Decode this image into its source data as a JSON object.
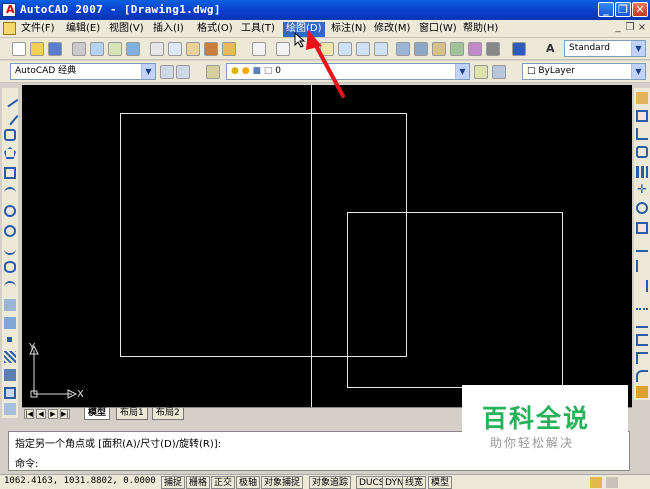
{
  "window": {
    "title": "AutoCAD 2007 - [Drawing1.dwg]",
    "minimize_glyph": "_",
    "restore_glyph": "❐",
    "close_glyph": "✕"
  },
  "menu": {
    "items": [
      "文件(F)",
      "编辑(E)",
      "视图(V)",
      "插入(I)",
      "格式(O)",
      "工具(T)",
      "绘图(D)",
      "标注(N)",
      "修改(M)",
      "窗口(W)",
      "帮助(H)"
    ],
    "highlighted": "绘图(D)",
    "mdi_minimize": "_",
    "mdi_restore": "❐",
    "mdi_close": "×"
  },
  "toolbar": {
    "text_style_value": "Standard",
    "workspace_value": "AutoCAD 经典",
    "layer_value": "0",
    "color_value": "ByLayer"
  },
  "tabs": [
    "模型",
    "布局1",
    "布局2"
  ],
  "active_tab": "模型",
  "ucs": {
    "y_label": "Y",
    "x_label": "X"
  },
  "command": {
    "line1": "指定另一个角点或 [面积(A)/尺寸(D)/旋转(R)]:",
    "line2": "命令:"
  },
  "status": {
    "coordinates": "1062.4163, 1031.8802, 0.0000",
    "toggles": [
      "捕捉",
      "栅格",
      "正交",
      "极轴",
      "对象捕捉",
      "对象追踪",
      "DUCS",
      "DYN",
      "线宽",
      "模型"
    ]
  },
  "watermark": {
    "title": "百科全说",
    "subtitle": "助你轻松解决"
  },
  "colors": {
    "highlight": "#316ac5",
    "annotation_arrow": "#e8131b",
    "watermark_green": "#25b35a"
  },
  "icons": [
    "autocad-app-icon",
    "new-icon",
    "open-icon",
    "save-icon",
    "print-icon",
    "undo-icon",
    "redo-icon",
    "zoom-icon",
    "pan-icon",
    "line-icon",
    "circle-icon",
    "arc-icon",
    "rectangle-icon",
    "hatch-icon",
    "move-icon",
    "copy-icon",
    "rotate-icon",
    "erase-icon",
    "layer-icon",
    "help-icon"
  ]
}
